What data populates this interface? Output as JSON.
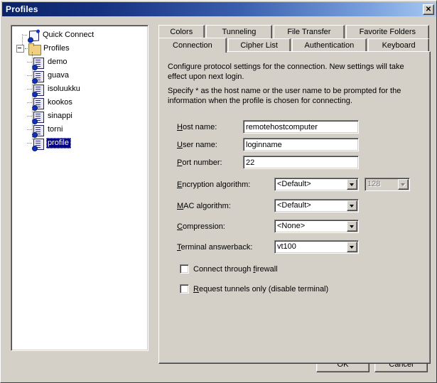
{
  "window": {
    "title": "Profiles",
    "close_label": "✕"
  },
  "tree": {
    "items": [
      {
        "label": "Quick Connect",
        "icon": "quick-connect-icon",
        "level": 0,
        "selected": false
      },
      {
        "label": "Profiles",
        "icon": "folder-icon",
        "level": 0,
        "selected": false,
        "expanded": true
      },
      {
        "label": "demo",
        "icon": "profile-icon",
        "level": 1,
        "selected": false
      },
      {
        "label": "guava",
        "icon": "profile-icon",
        "level": 1,
        "selected": false
      },
      {
        "label": "isoluukku",
        "icon": "profile-icon",
        "level": 1,
        "selected": false
      },
      {
        "label": "kookos",
        "icon": "profile-icon",
        "level": 1,
        "selected": false
      },
      {
        "label": "sinappi",
        "icon": "profile-icon",
        "level": 1,
        "selected": false
      },
      {
        "label": "torni",
        "icon": "profile-icon",
        "level": 1,
        "selected": false
      },
      {
        "label": "profile",
        "icon": "profile-icon",
        "level": 1,
        "selected": true
      }
    ]
  },
  "tabs": {
    "row1": [
      {
        "label": "Colors",
        "active": false
      },
      {
        "label": "Tunneling",
        "active": false
      },
      {
        "label": "File Transfer",
        "active": false
      },
      {
        "label": "Favorite Folders",
        "active": false
      }
    ],
    "row2": [
      {
        "label": "Connection",
        "active": true
      },
      {
        "label": "Cipher List",
        "active": false
      },
      {
        "label": "Authentication",
        "active": false
      },
      {
        "label": "Keyboard",
        "active": false
      }
    ]
  },
  "panel": {
    "description_1": "Configure protocol settings for the connection. New settings will take effect upon next login.",
    "description_2": "Specify * as the host name or the user name to be prompted for the information when the profile is chosen for connecting.",
    "fields": {
      "host_name": {
        "label_pre": "H",
        "label_post": "ost name:",
        "value": "remotehostcomputer"
      },
      "user_name": {
        "label_pre": "U",
        "label_post": "ser name:",
        "value": "loginname"
      },
      "port_number": {
        "label_pre": "P",
        "label_post": "ort number:",
        "value": "22"
      },
      "encryption_algorithm": {
        "label_pre": "E",
        "label_post": "ncryption algorithm:",
        "value": "<Default>"
      },
      "encryption_strength": {
        "value": "128",
        "disabled": true
      },
      "mac_algorithm": {
        "label_pre": "M",
        "label_post": "AC algorithm:",
        "value": "<Default>"
      },
      "compression": {
        "label_pre": "C",
        "label_post": "ompression:",
        "value": "<None>"
      },
      "terminal_answerback": {
        "label_pre": "T",
        "label_post": "erminal answerback:",
        "value": "vt100"
      }
    },
    "checkboxes": [
      {
        "label_pre": "Connect through ",
        "label_key": "f",
        "label_post": "irewall",
        "checked": false
      },
      {
        "label_pre": "",
        "label_key": "R",
        "label_post": "equest tunnels only (disable terminal)",
        "checked": false
      }
    ]
  },
  "footer": {
    "ok_label": "OK",
    "cancel_label": "Cancel"
  },
  "colors": {
    "face": "#d4d0c8",
    "title_start": "#0a246a",
    "title_end": "#a6c8f0",
    "selection": "#000080",
    "field_bg": "#ffffff",
    "disabled_text": "#808080"
  }
}
